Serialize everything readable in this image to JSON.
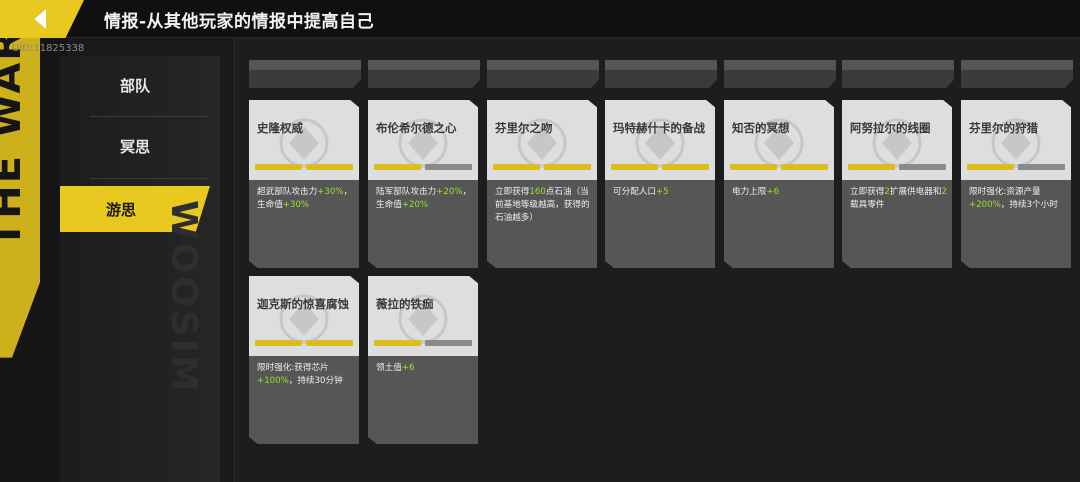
{
  "header": {
    "title": "情报-从其他玩家的情报中提高自己",
    "back_icon": "back-arrow-icon"
  },
  "uid": "UID:11825338",
  "nav": {
    "items": [
      {
        "label": "部队",
        "active": false
      },
      {
        "label": "冥思",
        "active": false
      },
      {
        "label": "游思",
        "active": true
      }
    ]
  },
  "decor": {
    "left_word": "THE WAR",
    "side_word": "WOOSIM"
  },
  "colors": {
    "accent": "#e9c820",
    "highlight_text": "#9be02a",
    "card_top": "#dedede",
    "card_bottom": "#565656"
  },
  "cards": [
    {
      "name": "史隆权威",
      "progress_fraction": 1.0,
      "desc": [
        {
          "t": "超武部队攻击力"
        },
        {
          "t": "+30%",
          "hl": true
        },
        {
          "t": "，生命值"
        },
        {
          "t": "+30%",
          "hl": true
        }
      ]
    },
    {
      "name": "布伦希尔德之心",
      "progress_fraction": 0.5,
      "desc": [
        {
          "t": "陆军部队攻击力"
        },
        {
          "t": "+20%",
          "hl": true
        },
        {
          "t": "，生命值"
        },
        {
          "t": "+20%",
          "hl": true
        }
      ]
    },
    {
      "name": "芬里尔之吻",
      "progress_fraction": 1.0,
      "desc": [
        {
          "t": "立即获得"
        },
        {
          "t": "160",
          "hl": true
        },
        {
          "t": "点石油（当前基地等级越高，获得的石油越多）"
        }
      ]
    },
    {
      "name": "玛特赫什卡的备战",
      "progress_fraction": 1.0,
      "desc": [
        {
          "t": "可分配人口"
        },
        {
          "t": "+5",
          "hl": true
        }
      ]
    },
    {
      "name": "知否的冥想",
      "progress_fraction": 1.0,
      "desc": [
        {
          "t": "电力上限"
        },
        {
          "t": "+6",
          "hl": true
        }
      ]
    },
    {
      "name": "阿努拉尔的线圈",
      "progress_fraction": 0.5,
      "desc": [
        {
          "t": "立即获得"
        },
        {
          "t": "2",
          "hl": true
        },
        {
          "t": "扩展供电器和"
        },
        {
          "t": "2",
          "hl": true
        },
        {
          "t": "载具零件"
        }
      ]
    },
    {
      "name": "芬里尔的狩猎",
      "progress_fraction": 0.5,
      "desc": [
        {
          "t": "限时强化:资源产量"
        },
        {
          "t": "+200%",
          "hl": true
        },
        {
          "t": "，持续3个小时"
        }
      ]
    },
    {
      "name": "迦克斯的惊喜腐蚀",
      "progress_fraction": 1.0,
      "desc": [
        {
          "t": "限时强化:获得芯片"
        },
        {
          "t": "+100%",
          "hl": true
        },
        {
          "t": "，持续30分钟"
        }
      ]
    },
    {
      "name": "薇拉的铁痂",
      "progress_fraction": 0.5,
      "desc": [
        {
          "t": "领土值"
        },
        {
          "t": "+6",
          "hl": true
        }
      ]
    }
  ]
}
